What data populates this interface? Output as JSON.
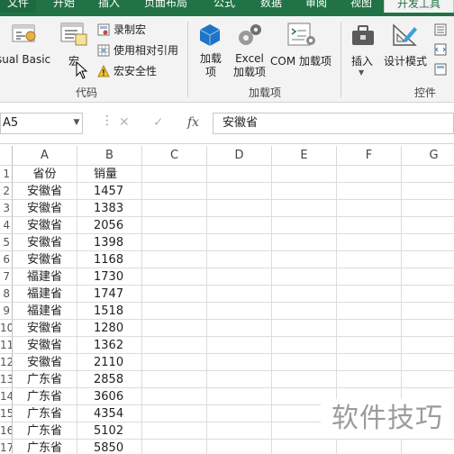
{
  "ribbon_tabs": [
    "文件",
    "开始",
    "插入",
    "页面布局",
    "公式",
    "数据",
    "审阅",
    "视图",
    "开发工具"
  ],
  "ribbon": {
    "code": {
      "visual_basic": "sual Basic",
      "macro": "宏",
      "record_macro": "录制宏",
      "relative_ref": "使用相对引用",
      "macro_security": "宏安全性",
      "group_label": "代码"
    },
    "addins": {
      "addins": "加载项",
      "excel_addins": "Excel 加载项",
      "com_addins": "COM 加载项",
      "group_label": "加载项"
    },
    "controls": {
      "insert": "插入",
      "design_mode": "设计模式",
      "group_label": "控件"
    }
  },
  "formula_bar": {
    "name_box": "A5",
    "cancel_symbol": "✕",
    "enter_symbol": "✓",
    "fx_symbol": "fx",
    "formula": "安徽省"
  },
  "columns": [
    "A",
    "B",
    "C",
    "D",
    "E",
    "F",
    "G"
  ],
  "row_numbers": [
    "1",
    "2",
    "3",
    "4",
    "5",
    "6",
    "7",
    "8",
    "9",
    "10",
    "11",
    "12",
    "13",
    "14",
    "15",
    "16",
    "17"
  ],
  "table": {
    "header": [
      "省份",
      "销量"
    ],
    "rows": [
      [
        "安徽省",
        "1457"
      ],
      [
        "安徽省",
        "1383"
      ],
      [
        "安徽省",
        "2056"
      ],
      [
        "安徽省",
        "1398"
      ],
      [
        "安徽省",
        "1168"
      ],
      [
        "福建省",
        "1730"
      ],
      [
        "福建省",
        "1747"
      ],
      [
        "福建省",
        "1518"
      ],
      [
        "安徽省",
        "1280"
      ],
      [
        "安徽省",
        "1362"
      ],
      [
        "安徽省",
        "2110"
      ],
      [
        "广东省",
        "2858"
      ],
      [
        "广东省",
        "3606"
      ],
      [
        "广东省",
        "4354"
      ],
      [
        "广东省",
        "5102"
      ],
      [
        "广东省",
        "5850"
      ]
    ]
  },
  "watermark": "软件技巧",
  "colors": {
    "ribbon_green": "#217346",
    "ribbon_bg": "#f3f3f3",
    "grid_line": "#dcdcdc"
  }
}
